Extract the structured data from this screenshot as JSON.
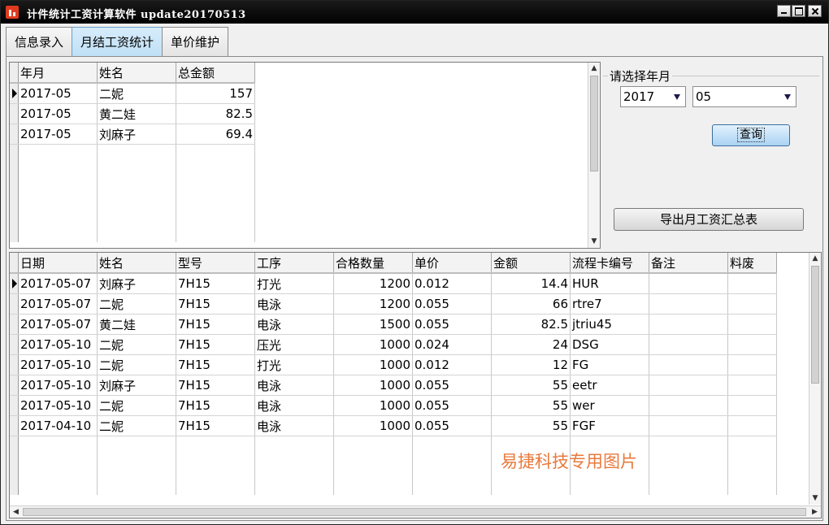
{
  "window": {
    "title": "计件统计工资计算软件 update20170513"
  },
  "tabs": [
    {
      "label": "信息录入"
    },
    {
      "label": "月结工资统计"
    },
    {
      "label": "单价维护"
    }
  ],
  "summary_grid": {
    "columns": [
      "年月",
      "姓名",
      "总金额"
    ],
    "rows": [
      [
        "2017-05",
        "二妮",
        "157"
      ],
      [
        "2017-05",
        "黄二娃",
        "82.5"
      ],
      [
        "2017-05",
        "刘麻子",
        "69.4"
      ]
    ]
  },
  "filter": {
    "legend": "请选择年月",
    "year": "2017",
    "month": "05",
    "query_label": "查询",
    "export_label": "导出月工资汇总表"
  },
  "detail_grid": {
    "columns": [
      "日期",
      "姓名",
      "型号",
      "工序",
      "合格数量",
      "单价",
      "金额",
      "流程卡编号",
      "备注",
      "料废"
    ],
    "rows": [
      [
        "2017-05-07",
        "刘麻子",
        "7H15",
        "打光",
        "1200",
        "0.012",
        "14.4",
        "HUR",
        "",
        ""
      ],
      [
        "2017-05-07",
        "二妮",
        "7H15",
        "电泳",
        "1200",
        "0.055",
        "66",
        "rtre7",
        "",
        ""
      ],
      [
        "2017-05-07",
        "黄二娃",
        "7H15",
        "电泳",
        "1500",
        "0.055",
        "82.5",
        "jtriu45",
        "",
        ""
      ],
      [
        "2017-05-10",
        "二妮",
        "7H15",
        "压光",
        "1000",
        "0.024",
        "24",
        "DSG",
        "",
        ""
      ],
      [
        "2017-05-10",
        "二妮",
        "7H15",
        "打光",
        "1000",
        "0.012",
        "12",
        "FG",
        "",
        ""
      ],
      [
        "2017-05-10",
        "刘麻子",
        "7H15",
        "电泳",
        "1000",
        "0.055",
        "55",
        "eetr",
        "",
        ""
      ],
      [
        "2017-05-10",
        "二妮",
        "7H15",
        "电泳",
        "1000",
        "0.055",
        "55",
        "wer",
        "",
        ""
      ],
      [
        "2017-04-10",
        "二妮",
        "7H15",
        "电泳",
        "1000",
        "0.055",
        "55",
        "FGF",
        "",
        ""
      ]
    ]
  },
  "watermark": "易捷科技专用图片"
}
